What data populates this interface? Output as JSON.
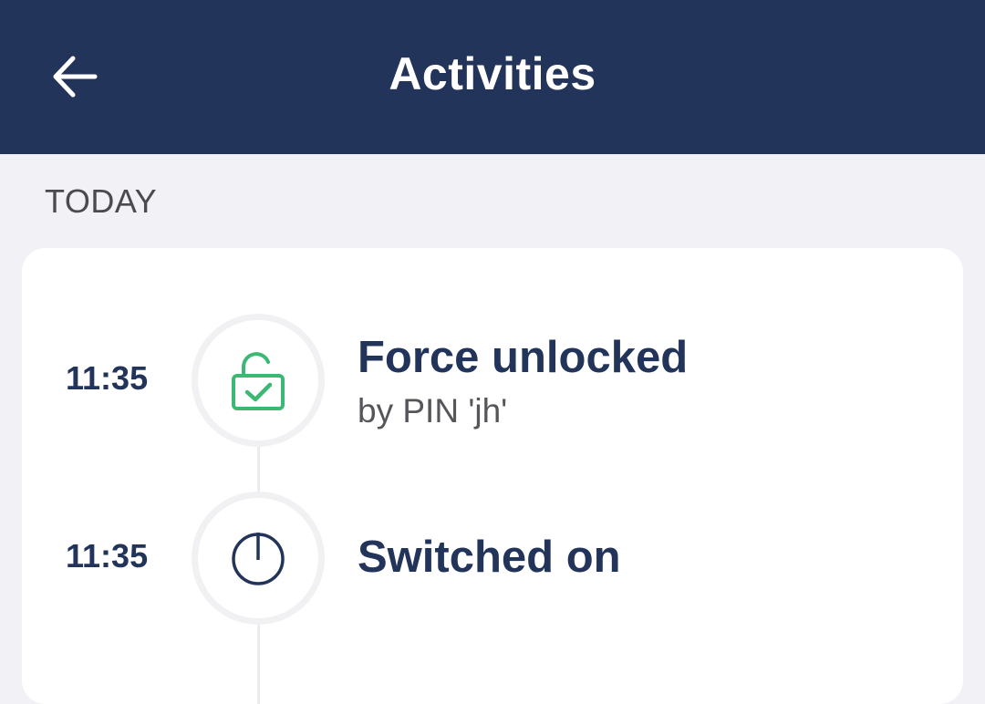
{
  "header": {
    "title": "Activities",
    "back_icon": "arrow-left-icon",
    "background": "#23345a"
  },
  "section": {
    "label": "TODAY"
  },
  "activities": [
    {
      "time": "11:35",
      "title": "Force unlocked",
      "subtitle": "by PIN 'jh'",
      "icon": "unlocked-padlock-check-icon",
      "icon_color": "#3bb873"
    },
    {
      "time": "11:35",
      "title": "Switched on",
      "subtitle": "",
      "icon": "power-icon",
      "icon_color": "#23345a"
    }
  ]
}
